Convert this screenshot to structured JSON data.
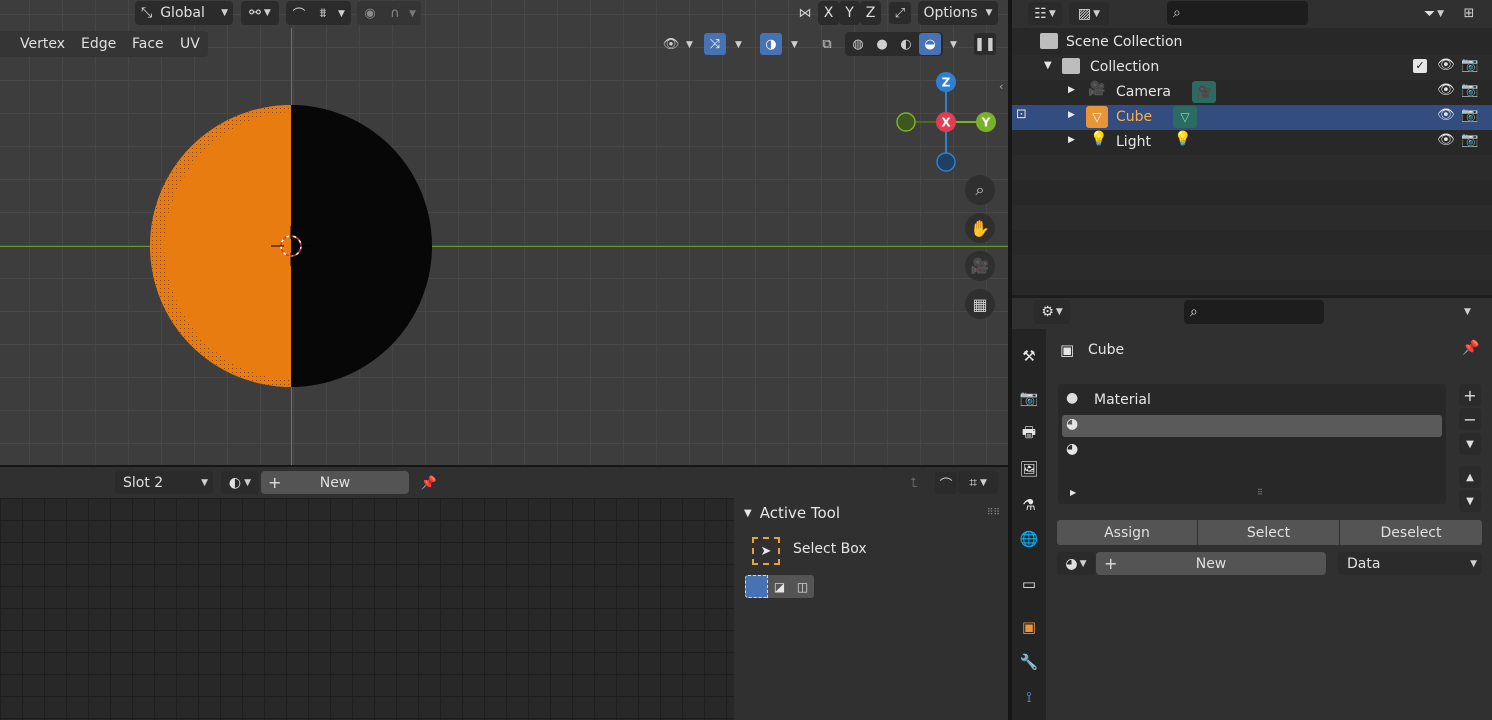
{
  "viewport": {
    "header": {
      "orientation": "Global",
      "options": "Options",
      "axis_x": "X",
      "axis_y": "Y",
      "axis_z": "Z"
    },
    "select_modes": [
      "Vertex",
      "Edge",
      "Face",
      "UV"
    ],
    "gizmo": {
      "z": "Z",
      "x": "X",
      "y": "Y"
    },
    "colors": {
      "bg": "#3d3d3d",
      "orange": "#e87c10",
      "x_axis": "#e43c55",
      "y_axis": "#7ab12b",
      "z_axis": "#2f80d1"
    }
  },
  "uv_header": {
    "slot": "Slot 2",
    "new_label": "New"
  },
  "tool_panel": {
    "title": "Active Tool",
    "tool_name": "Select Box"
  },
  "outliner": {
    "rows": [
      {
        "label": "Scene Collection"
      },
      {
        "label": "Collection"
      },
      {
        "label": "Camera"
      },
      {
        "label": "Cube"
      },
      {
        "label": "Light"
      }
    ]
  },
  "properties": {
    "object_name": "Cube",
    "material_slots": [
      "Material",
      "",
      ""
    ],
    "assign": "Assign",
    "select": "Select",
    "deselect": "Deselect",
    "new_label": "New",
    "link": "Data"
  }
}
